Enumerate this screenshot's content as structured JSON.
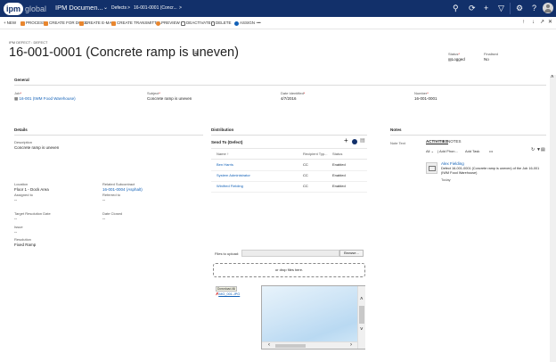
{
  "topnav": {
    "logo_ipm": "ipm",
    "logo_global": "global",
    "app_name": "IPM Documen...",
    "crumb_1": "Defects",
    "crumb_sep_1": ">",
    "crumb_2": "16-001-0001 (Concr...",
    "crumb_sep_2": ">"
  },
  "cmdbar": {
    "new": "NEW",
    "process": "PROCESS",
    "create_for_docs": "CREATE FOR DOCS",
    "create_email": "CREATE E-MAIL",
    "create_transmittal": "CREATE TRANSMITTAL",
    "preview": "PREVIEW",
    "deactivate": "DEACTIVATE",
    "delete": "DELETE",
    "assign": "ASSIGN",
    "more": "•••"
  },
  "header": {
    "entity_label": "IPM DEFECT : DEFECT",
    "title": "16-001-0001 (Concrete ramp is uneven)",
    "status_label": "Status",
    "status_value": "Logged",
    "finalised_label": "Finalised",
    "finalised_value": "No"
  },
  "general": {
    "heading": "General",
    "job_label": "Job",
    "job_value": "16-001 (IWM Food Warehouse)",
    "subject_label": "Subject",
    "subject_value": "Concrete ramp is uneven",
    "date_label": "Date Identified",
    "date_value": "4/7/2016",
    "number_label": "Number",
    "number_value": "16-001-0001"
  },
  "details": {
    "heading": "Details",
    "description_label": "Description",
    "description_value": "Concrete ramp is uneven",
    "location_label": "Location",
    "location_value": "Floor 1 - Dock Area",
    "related_label": "Related Subcontract",
    "related_value": "16-001-0004 (Asphalt)",
    "assigned_label": "Assigned to",
    "assigned_value": "--",
    "referred_label": "Referred to",
    "referred_value": "--",
    "target_label": "Target Resolution Date",
    "target_value": "--",
    "closed_label": "Date Closed",
    "closed_value": "--",
    "issue_label": "Issue",
    "issue_value": "--",
    "resolution_label": "Resolution",
    "resolution_value": "Fixed Ramp"
  },
  "distribution": {
    "heading": "Distribution",
    "subgrid_title": "Send To (Defect)",
    "columns": [
      "Name ↑",
      "Recipient Typ...",
      "Status"
    ],
    "rows": [
      {
        "name": "Ben Harris",
        "type": "CC",
        "status": "Enabled"
      },
      {
        "name": "System Administrator",
        "type": "CC",
        "status": "Enabled"
      },
      {
        "name": "Winifred Fielding",
        "type": "CC",
        "status": "Enabled"
      }
    ],
    "files_label": "Files to upload:",
    "browse_label": "Browse...",
    "drop_label": "or drop files here.",
    "download_all": "Download All",
    "attachment_name": "IMG_001.JPG"
  },
  "notes": {
    "heading": "Notes",
    "note_text_label": "Note Text",
    "tab_activities": "ACTIVITIES",
    "tab_notes": "NOTES",
    "filter_all": "All",
    "add_phone": "Add Phon...",
    "add_task": "Add Task",
    "more": "•••",
    "item_author": "Alex Fielding",
    "item_text_1": "Defect 16-001-0001 (Concrete ramp is uneven) of the Job 16-001",
    "item_text_2": "(IWM Food Warehouse)",
    "item_time": "Today"
  },
  "colors": {
    "nav_bg": "#12306a",
    "accent_orange": "#e8862e",
    "link_blue": "#1160b7"
  }
}
